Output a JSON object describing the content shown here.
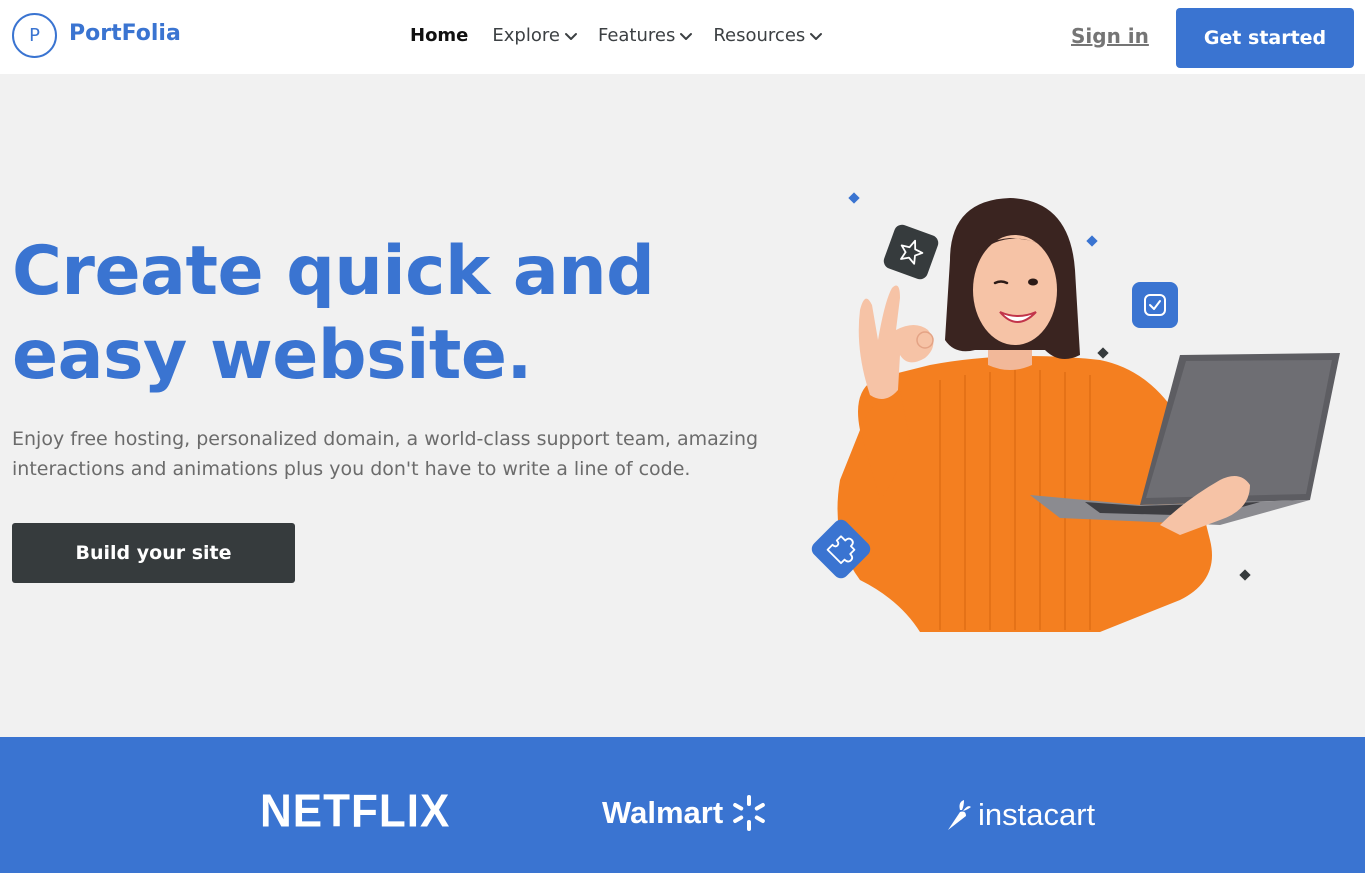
{
  "brand": {
    "logo_letter": "P",
    "name": "PortFolia",
    "color": "#3a74d1"
  },
  "nav": {
    "items": [
      {
        "label": "Home",
        "active": true,
        "has_dropdown": false
      },
      {
        "label": "Explore",
        "active": false,
        "has_dropdown": true
      },
      {
        "label": "Features",
        "active": false,
        "has_dropdown": true
      },
      {
        "label": "Resources",
        "active": false,
        "has_dropdown": true
      }
    ],
    "signin_label": "Sign in",
    "cta_label": "Get started"
  },
  "hero": {
    "title": "Create quick and easy website.",
    "subtitle": "Enjoy free hosting, personalized domain, a world-class support team, amazing interactions and animations plus you don't have to write a line of code.",
    "button_label": "Build your site",
    "illustration_icons": [
      "star-badge-icon",
      "check-badge-icon",
      "puzzle-badge-icon"
    ]
  },
  "brands": {
    "items": [
      "NETFLIX",
      "Walmart",
      "instacart"
    ],
    "background": "#3a74d1"
  }
}
